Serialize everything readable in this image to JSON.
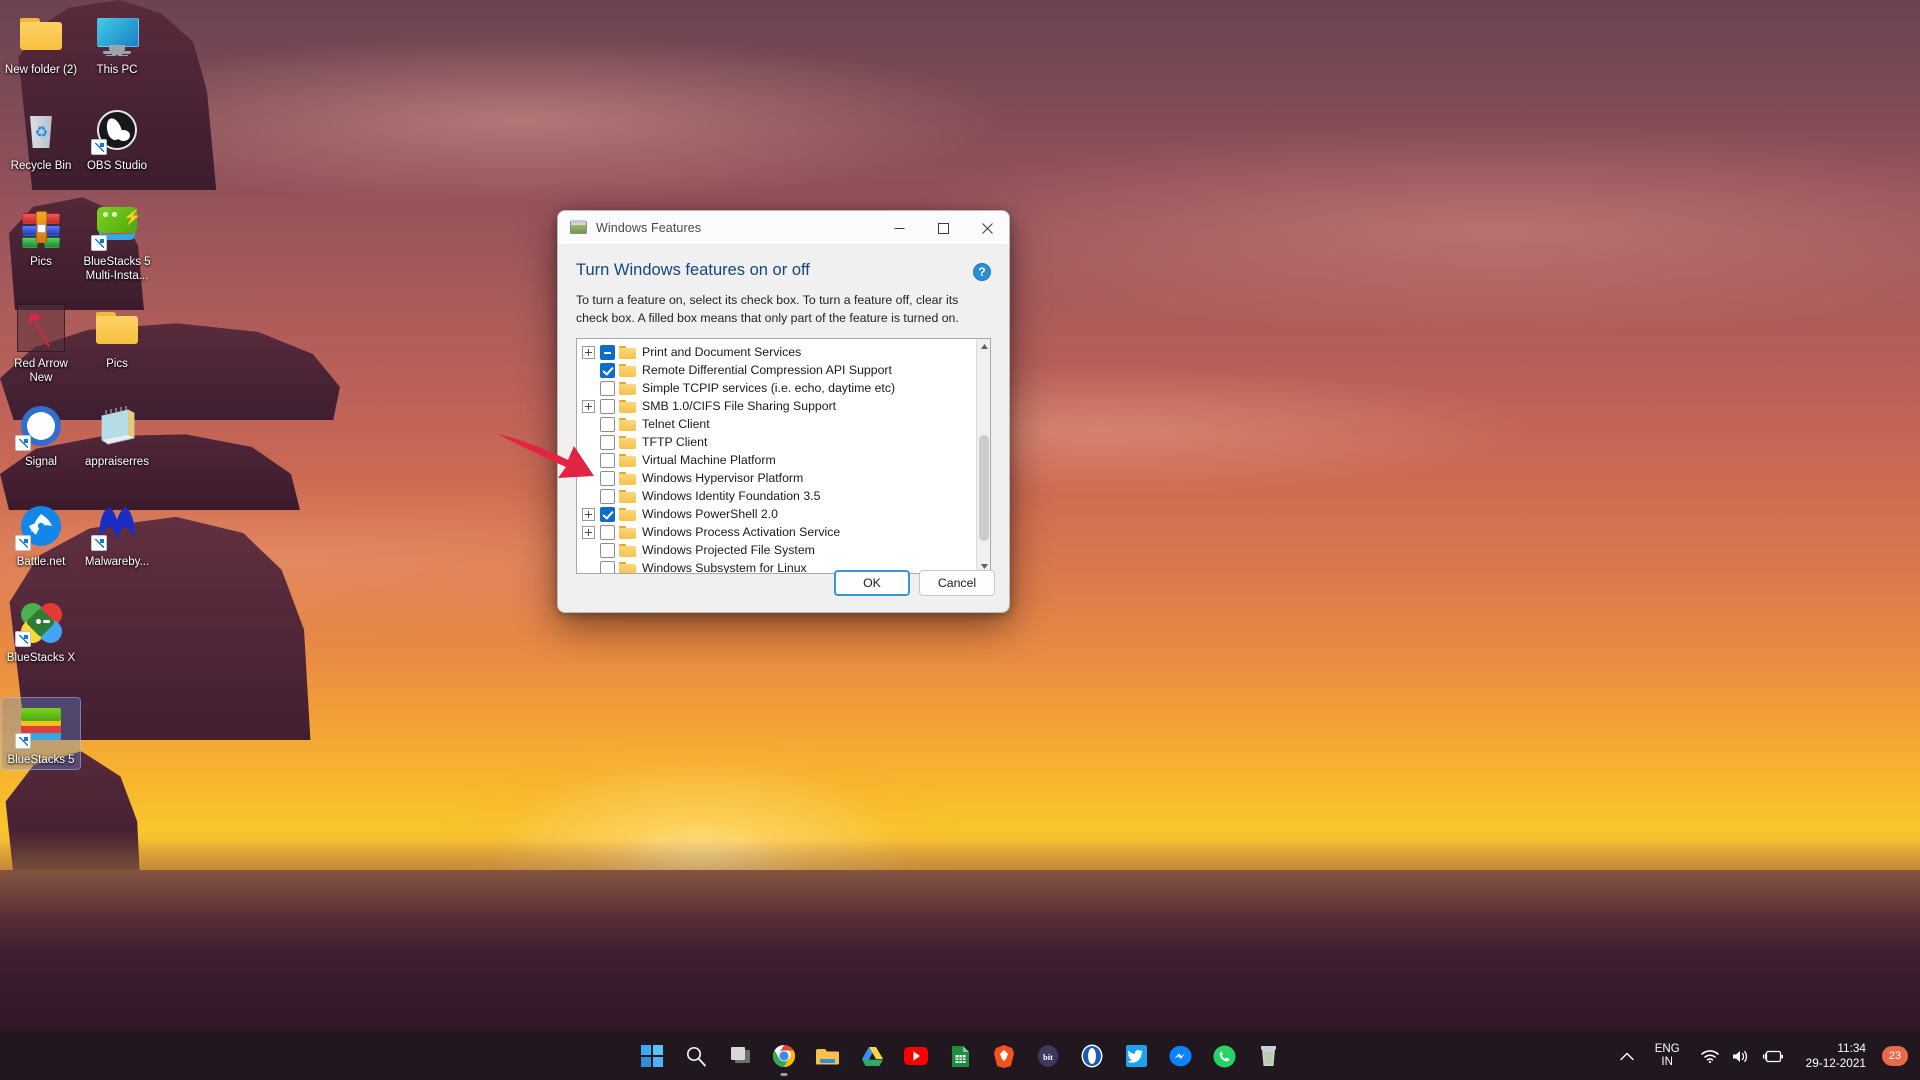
{
  "desktop": {
    "icons": [
      {
        "label": "New folder (2)",
        "icon": "folder-icon",
        "selected": false,
        "shortcut": false
      },
      {
        "label": "This PC",
        "icon": "this-pc-icon",
        "selected": false,
        "shortcut": false
      },
      {
        "label": "Recycle Bin",
        "icon": "recycle-bin-icon",
        "selected": false,
        "shortcut": false
      },
      {
        "label": "OBS Studio",
        "icon": "obs-studio-icon",
        "selected": false,
        "shortcut": true
      },
      {
        "label": "Pics",
        "icon": "winrar-archive-icon",
        "selected": false,
        "shortcut": false
      },
      {
        "label": "BlueStacks 5 Multi-Insta...",
        "icon": "bluestacks-multi-instance-icon",
        "selected": false,
        "shortcut": true
      },
      {
        "label": "Red Arrow New",
        "icon": "red-arrow-image-icon",
        "selected": false,
        "shortcut": false
      },
      {
        "label": "Pics",
        "icon": "folder-icon",
        "selected": false,
        "shortcut": false
      },
      {
        "label": "Signal",
        "icon": "signal-icon",
        "selected": false,
        "shortcut": true
      },
      {
        "label": "appraiserres",
        "icon": "notepad-document-icon",
        "selected": false,
        "shortcut": false
      },
      {
        "label": "Battle.net",
        "icon": "battle-net-icon",
        "selected": false,
        "shortcut": true
      },
      {
        "label": "Malwareby...",
        "icon": "malwarebytes-icon",
        "selected": false,
        "shortcut": true
      },
      {
        "label": "BlueStacks X",
        "icon": "bluestacks-x-icon",
        "selected": false,
        "shortcut": true
      },
      {
        "label": "BlueStacks 5",
        "icon": "bluestacks-5-icon",
        "selected": true,
        "shortcut": true
      }
    ]
  },
  "dialog": {
    "title": "Windows Features",
    "heading": "Turn Windows features on or off",
    "description": "To turn a feature on, select its check box. To turn a feature off, clear its check box. A filled box means that only part of the feature is turned on.",
    "help_label": "?",
    "window_controls": {
      "minimize": "minimize-button",
      "maximize": "maximize-button",
      "close": "close-button"
    },
    "features": [
      {
        "label": "Print and Document Services",
        "state": "partial",
        "expandable": true,
        "indent": 0
      },
      {
        "label": "Remote Differential Compression API Support",
        "state": "checked",
        "expandable": false,
        "indent": 0
      },
      {
        "label": "Simple TCPIP services (i.e. echo, daytime etc)",
        "state": "unchecked",
        "expandable": false,
        "indent": 0
      },
      {
        "label": "SMB 1.0/CIFS File Sharing Support",
        "state": "unchecked",
        "expandable": true,
        "indent": 0
      },
      {
        "label": "Telnet Client",
        "state": "unchecked",
        "expandable": false,
        "indent": 0
      },
      {
        "label": "TFTP Client",
        "state": "unchecked",
        "expandable": false,
        "indent": 0
      },
      {
        "label": "Virtual Machine Platform",
        "state": "unchecked",
        "expandable": false,
        "indent": 0
      },
      {
        "label": "Windows Hypervisor Platform",
        "state": "unchecked",
        "expandable": false,
        "indent": 0
      },
      {
        "label": "Windows Identity Foundation 3.5",
        "state": "unchecked",
        "expandable": false,
        "indent": 0
      },
      {
        "label": "Windows PowerShell 2.0",
        "state": "checked",
        "expandable": true,
        "indent": 0
      },
      {
        "label": "Windows Process Activation Service",
        "state": "unchecked",
        "expandable": true,
        "indent": 0
      },
      {
        "label": "Windows Projected File System",
        "state": "unchecked",
        "expandable": false,
        "indent": 0
      },
      {
        "label": "Windows Subsystem for Linux",
        "state": "unchecked",
        "expandable": false,
        "indent": 0
      }
    ],
    "buttons": {
      "ok": "OK",
      "cancel": "Cancel"
    }
  },
  "annotation": {
    "arrow_color": "#e02441",
    "arrow_target": "Windows Hypervisor Platform"
  },
  "taskbar": {
    "items": [
      {
        "name": "start-button",
        "icon": "windows-logo-icon",
        "active": false
      },
      {
        "name": "search-button",
        "icon": "search-icon",
        "active": false
      },
      {
        "name": "task-view-button",
        "icon": "task-view-icon",
        "active": false
      },
      {
        "name": "chrome-button",
        "icon": "google-chrome-icon",
        "active": true
      },
      {
        "name": "file-explorer-button",
        "icon": "file-explorer-icon",
        "active": false
      },
      {
        "name": "google-drive-button",
        "icon": "google-drive-icon",
        "active": false
      },
      {
        "name": "youtube-button",
        "icon": "youtube-icon",
        "active": false
      },
      {
        "name": "google-sheets-button",
        "icon": "google-sheets-icon",
        "active": false
      },
      {
        "name": "brave-button",
        "icon": "brave-browser-icon",
        "active": false
      },
      {
        "name": "bit-button",
        "icon": "bit-icon",
        "active": false
      },
      {
        "name": "opera-button",
        "icon": "opera-icon",
        "active": false
      },
      {
        "name": "twitter-button",
        "icon": "twitter-icon",
        "active": false
      },
      {
        "name": "messenger-button",
        "icon": "messenger-icon",
        "active": false
      },
      {
        "name": "whatsapp-button",
        "icon": "whatsapp-icon",
        "active": false
      },
      {
        "name": "recycle-bin-taskbar-button",
        "icon": "recycle-bin-icon",
        "active": false
      }
    ],
    "tray": {
      "show_hidden_label": "show-hidden-icons",
      "language_line1": "ENG",
      "language_line2": "IN",
      "network_icon": "wifi-icon",
      "volume_icon": "speaker-icon",
      "battery_icon": "battery-charging-icon",
      "time": "11:34",
      "date": "29-12-2021",
      "notification_count": "23"
    }
  },
  "colors": {
    "accent_blue": "#0d6cc7",
    "heading_blue": "#13477e",
    "arrow_red": "#e02441",
    "badge_orange": "#e86a4a"
  }
}
